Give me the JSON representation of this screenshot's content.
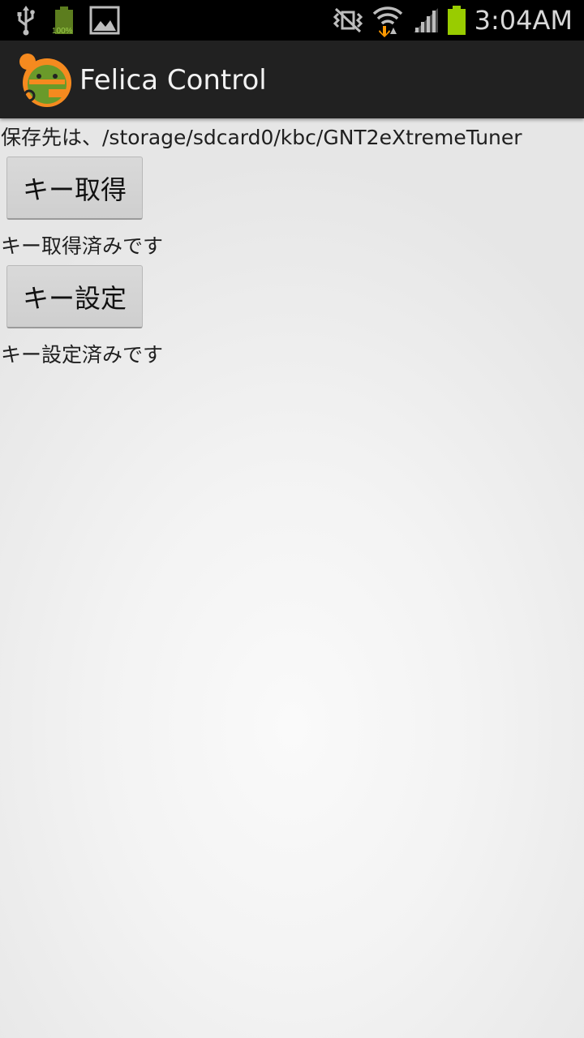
{
  "status_bar": {
    "time": "3:04AM",
    "battery_small_label": "100%",
    "icons": [
      "usb-icon",
      "battery-full-icon",
      "picture-icon",
      "vibrate-mute-icon",
      "wifi-icon",
      "signal-icon",
      "battery-icon"
    ],
    "battery_color": "#99cc00"
  },
  "action_bar": {
    "title": "Felica Control",
    "icon": "felica-app-icon"
  },
  "main": {
    "save_path_text": "保存先は、/storage/sdcard0/kbc/GNT2eXtremeTuner",
    "get_key_button_label": "キー取得",
    "get_key_status": "キー取得済みです",
    "set_key_button_label": "キー設定",
    "set_key_status": "キー設定済みです"
  }
}
